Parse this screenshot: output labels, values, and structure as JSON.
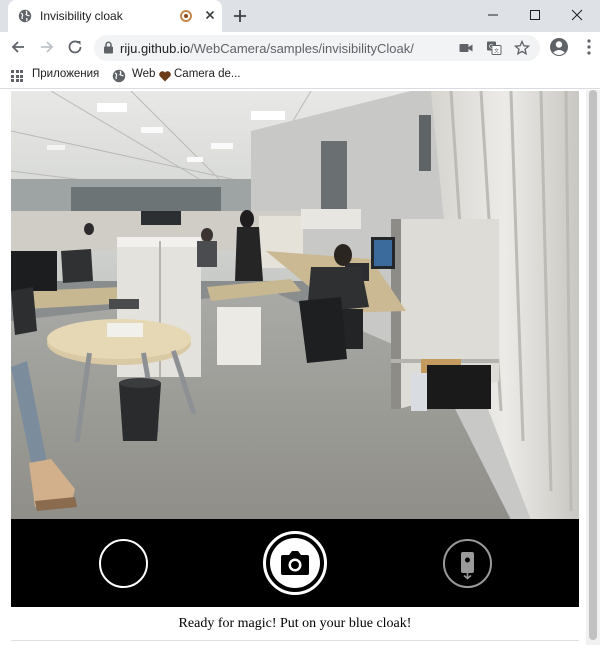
{
  "browser": {
    "tab_title": "Invisibility cloak",
    "url_host": "riju.github.io",
    "url_path": "/WebCamera/samples/invisibilityCloak/"
  },
  "bookmarks": {
    "apps_label": "Приложения",
    "web_label": "Web",
    "camera_label": "Camera de..."
  },
  "page": {
    "status_text": "Ready for magic! Put on your blue cloak!"
  },
  "icons": {
    "tab_favicon": "globe-icon",
    "tab_audio": "recording-indicator-icon",
    "camera_in_use": "video-camera-icon",
    "translate": "translate-icon",
    "bookmark": "star-icon",
    "profile": "account-icon",
    "snapshot": "camera-icon",
    "switch_camera": "switch-camera-icon"
  },
  "colors": {
    "tabstrip_bg": "#dee1e6",
    "omnibox_bg": "#f1f3f4",
    "controls_bg": "#000000",
    "heart": "#6b3b17"
  }
}
